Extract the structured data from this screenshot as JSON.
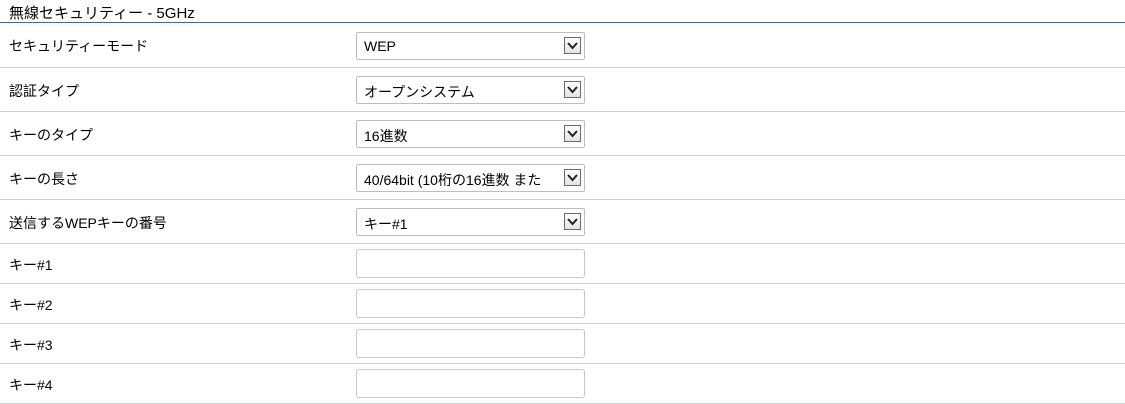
{
  "section": {
    "title": "無線セキュリティー - 5GHz"
  },
  "fields": {
    "security_mode": {
      "label": "セキュリティーモード",
      "value": "WEP"
    },
    "auth_type": {
      "label": "認証タイプ",
      "value": "オープンシステム"
    },
    "key_type": {
      "label": "キーのタイプ",
      "value": "16進数"
    },
    "key_length": {
      "label": "キーの長さ",
      "value": "40/64bit (10桁の16進数 また"
    },
    "tx_key_index": {
      "label": "送信するWEPキーの番号",
      "value": "キー#1"
    },
    "key1": {
      "label": "キー#1",
      "value": ""
    },
    "key2": {
      "label": "キー#2",
      "value": ""
    },
    "key3": {
      "label": "キー#3",
      "value": ""
    },
    "key4": {
      "label": "キー#4",
      "value": ""
    }
  },
  "icons": {
    "dropdown": "chevron-down-icon"
  },
  "colors": {
    "title_rule": "#4a6a80",
    "row_divider": "#c5d3dc"
  }
}
